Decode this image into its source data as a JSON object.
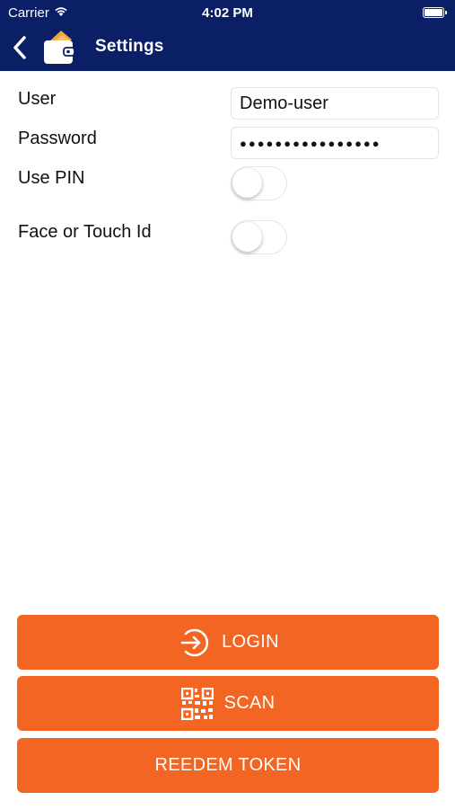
{
  "status_bar": {
    "carrier": "Carrier",
    "time": "4:02 PM"
  },
  "nav": {
    "title": "Settings"
  },
  "form": {
    "user_label": "User",
    "user_value": "Demo-user",
    "password_label": "Password",
    "password_value": "●●●●●●●●●●●●●●●●",
    "pin_label": "Use PIN",
    "pin_enabled": false,
    "biometric_label": "Face or Touch Id",
    "biometric_enabled": false
  },
  "buttons": {
    "login": "LOGIN",
    "scan": "SCAN",
    "redeem": "REEDEM TOKEN"
  },
  "colors": {
    "header": "#0a1f66",
    "accent": "#f26522"
  },
  "icons": [
    "back-icon",
    "wallet-icon",
    "login-icon",
    "qr-code-icon",
    "wifi-icon",
    "battery-icon"
  ]
}
